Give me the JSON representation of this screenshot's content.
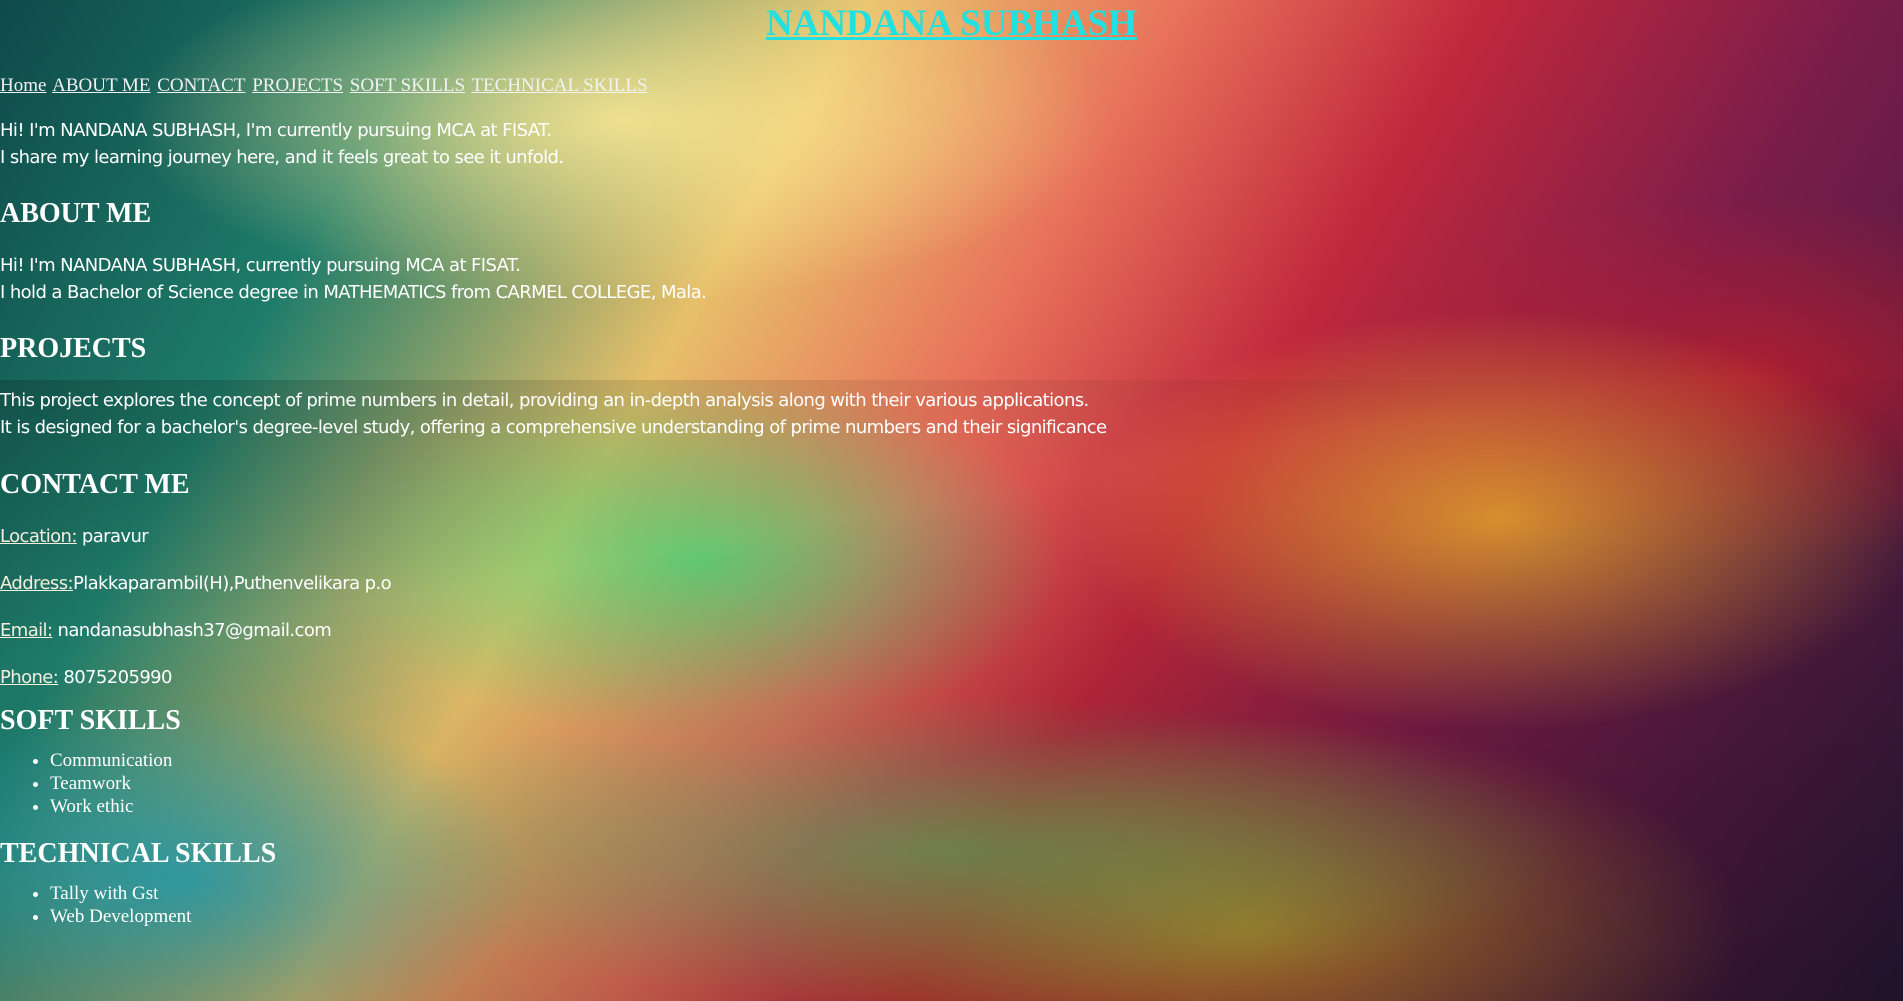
{
  "header": {
    "title": "NANDANA SUBHASH"
  },
  "nav": {
    "items": [
      {
        "label": "Home"
      },
      {
        "label": "ABOUT ME"
      },
      {
        "label": "CONTACT"
      },
      {
        "label": "PROJECTS"
      },
      {
        "label": "SOFT SKILLS"
      },
      {
        "label": "TECHNICAL SKILLS"
      }
    ]
  },
  "intro": {
    "line1": "Hi! I'm NANDANA SUBHASH, I'm currently pursuing MCA at FISAT.",
    "line2": "I share my learning journey here, and it feels great to see it unfold."
  },
  "about": {
    "heading": "ABOUT ME",
    "line1": "Hi! I'm NANDANA SUBHASH, currently pursuing MCA at FISAT.",
    "line2": "I hold a Bachelor of Science degree in MATHEMATICS from CARMEL COLLEGE, Mala."
  },
  "projects": {
    "heading": "PROJECTS",
    "line1": "This project explores the concept of prime numbers in detail, providing an in-depth analysis along with their various applications.",
    "line2": "It is designed for a bachelor's degree-level study, offering a comprehensive understanding of prime numbers and their significance"
  },
  "contact": {
    "heading": "CONTACT ME",
    "location_label": "Location:",
    "location_value": " paravur",
    "address_label": "Address:",
    "address_value": "Plakkaparambil(H),Puthenvelikara p.o",
    "email_label": "Email:",
    "email_value": " nandanasubhash37@gmail.com",
    "phone_label": "Phone:",
    "phone_value": " 8075205990"
  },
  "soft_skills": {
    "heading": "SOFT SKILLS",
    "items": [
      "Communication",
      "Teamwork",
      "Work ethic"
    ]
  },
  "technical_skills": {
    "heading": "TECHNICAL SKILLS",
    "items": [
      "Tally with Gst",
      "Web Development"
    ]
  },
  "colors": {
    "title": "#21e0e0",
    "text": "#ffffff"
  }
}
